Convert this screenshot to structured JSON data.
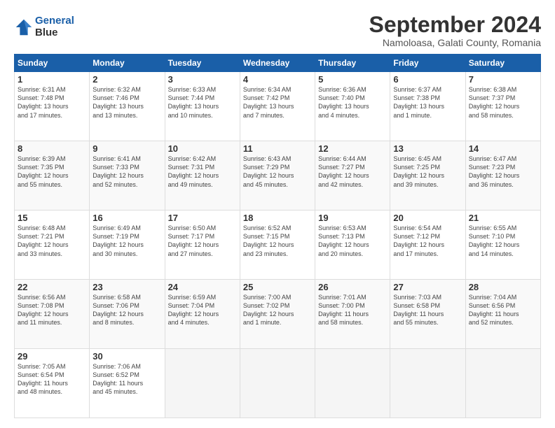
{
  "logo": {
    "line1": "General",
    "line2": "Blue"
  },
  "title": "September 2024",
  "subtitle": "Namoloasa, Galati County, Romania",
  "headers": [
    "Sunday",
    "Monday",
    "Tuesday",
    "Wednesday",
    "Thursday",
    "Friday",
    "Saturday"
  ],
  "weeks": [
    [
      {
        "day": "1",
        "info": "Sunrise: 6:31 AM\nSunset: 7:48 PM\nDaylight: 13 hours\nand 17 minutes."
      },
      {
        "day": "2",
        "info": "Sunrise: 6:32 AM\nSunset: 7:46 PM\nDaylight: 13 hours\nand 13 minutes."
      },
      {
        "day": "3",
        "info": "Sunrise: 6:33 AM\nSunset: 7:44 PM\nDaylight: 13 hours\nand 10 minutes."
      },
      {
        "day": "4",
        "info": "Sunrise: 6:34 AM\nSunset: 7:42 PM\nDaylight: 13 hours\nand 7 minutes."
      },
      {
        "day": "5",
        "info": "Sunrise: 6:36 AM\nSunset: 7:40 PM\nDaylight: 13 hours\nand 4 minutes."
      },
      {
        "day": "6",
        "info": "Sunrise: 6:37 AM\nSunset: 7:38 PM\nDaylight: 13 hours\nand 1 minute."
      },
      {
        "day": "7",
        "info": "Sunrise: 6:38 AM\nSunset: 7:37 PM\nDaylight: 12 hours\nand 58 minutes."
      }
    ],
    [
      {
        "day": "8",
        "info": "Sunrise: 6:39 AM\nSunset: 7:35 PM\nDaylight: 12 hours\nand 55 minutes."
      },
      {
        "day": "9",
        "info": "Sunrise: 6:41 AM\nSunset: 7:33 PM\nDaylight: 12 hours\nand 52 minutes."
      },
      {
        "day": "10",
        "info": "Sunrise: 6:42 AM\nSunset: 7:31 PM\nDaylight: 12 hours\nand 49 minutes."
      },
      {
        "day": "11",
        "info": "Sunrise: 6:43 AM\nSunset: 7:29 PM\nDaylight: 12 hours\nand 45 minutes."
      },
      {
        "day": "12",
        "info": "Sunrise: 6:44 AM\nSunset: 7:27 PM\nDaylight: 12 hours\nand 42 minutes."
      },
      {
        "day": "13",
        "info": "Sunrise: 6:45 AM\nSunset: 7:25 PM\nDaylight: 12 hours\nand 39 minutes."
      },
      {
        "day": "14",
        "info": "Sunrise: 6:47 AM\nSunset: 7:23 PM\nDaylight: 12 hours\nand 36 minutes."
      }
    ],
    [
      {
        "day": "15",
        "info": "Sunrise: 6:48 AM\nSunset: 7:21 PM\nDaylight: 12 hours\nand 33 minutes."
      },
      {
        "day": "16",
        "info": "Sunrise: 6:49 AM\nSunset: 7:19 PM\nDaylight: 12 hours\nand 30 minutes."
      },
      {
        "day": "17",
        "info": "Sunrise: 6:50 AM\nSunset: 7:17 PM\nDaylight: 12 hours\nand 27 minutes."
      },
      {
        "day": "18",
        "info": "Sunrise: 6:52 AM\nSunset: 7:15 PM\nDaylight: 12 hours\nand 23 minutes."
      },
      {
        "day": "19",
        "info": "Sunrise: 6:53 AM\nSunset: 7:13 PM\nDaylight: 12 hours\nand 20 minutes."
      },
      {
        "day": "20",
        "info": "Sunrise: 6:54 AM\nSunset: 7:12 PM\nDaylight: 12 hours\nand 17 minutes."
      },
      {
        "day": "21",
        "info": "Sunrise: 6:55 AM\nSunset: 7:10 PM\nDaylight: 12 hours\nand 14 minutes."
      }
    ],
    [
      {
        "day": "22",
        "info": "Sunrise: 6:56 AM\nSunset: 7:08 PM\nDaylight: 12 hours\nand 11 minutes."
      },
      {
        "day": "23",
        "info": "Sunrise: 6:58 AM\nSunset: 7:06 PM\nDaylight: 12 hours\nand 8 minutes."
      },
      {
        "day": "24",
        "info": "Sunrise: 6:59 AM\nSunset: 7:04 PM\nDaylight: 12 hours\nand 4 minutes."
      },
      {
        "day": "25",
        "info": "Sunrise: 7:00 AM\nSunset: 7:02 PM\nDaylight: 12 hours\nand 1 minute."
      },
      {
        "day": "26",
        "info": "Sunrise: 7:01 AM\nSunset: 7:00 PM\nDaylight: 11 hours\nand 58 minutes."
      },
      {
        "day": "27",
        "info": "Sunrise: 7:03 AM\nSunset: 6:58 PM\nDaylight: 11 hours\nand 55 minutes."
      },
      {
        "day": "28",
        "info": "Sunrise: 7:04 AM\nSunset: 6:56 PM\nDaylight: 11 hours\nand 52 minutes."
      }
    ],
    [
      {
        "day": "29",
        "info": "Sunrise: 7:05 AM\nSunset: 6:54 PM\nDaylight: 11 hours\nand 48 minutes."
      },
      {
        "day": "30",
        "info": "Sunrise: 7:06 AM\nSunset: 6:52 PM\nDaylight: 11 hours\nand 45 minutes."
      },
      {
        "day": "",
        "info": ""
      },
      {
        "day": "",
        "info": ""
      },
      {
        "day": "",
        "info": ""
      },
      {
        "day": "",
        "info": ""
      },
      {
        "day": "",
        "info": ""
      }
    ]
  ]
}
